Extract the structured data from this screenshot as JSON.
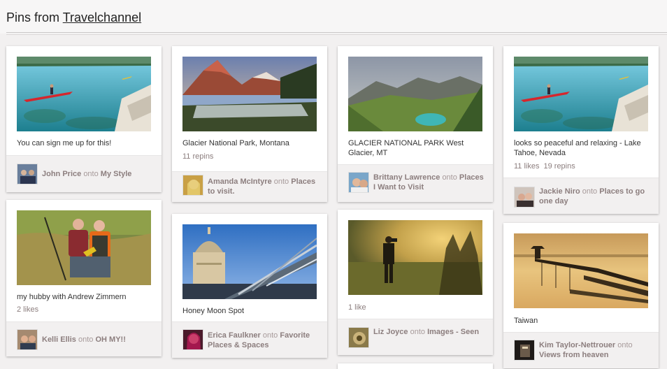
{
  "header": {
    "prefix": "Pins from",
    "user": "Travelchannel"
  },
  "pins": [
    {
      "description": "You can sign me up for this!",
      "stats": [],
      "pinner": "John Price",
      "onto": "onto",
      "board": "My Style",
      "image": "kayak-lake-icon"
    },
    {
      "description": "my hubby with Andrew Zimmern",
      "stats": [
        "2 likes"
      ],
      "pinner": "Kelli Ellis",
      "onto": "onto",
      "board": "OH MY!!",
      "image": "two-men-field-icon"
    },
    {
      "description": "Glacier National Park, Montana",
      "stats": [
        "11 repins"
      ],
      "pinner": "Amanda McIntyre",
      "onto": "onto",
      "board": "Places to visit.",
      "image": "mountain-lake-icon"
    },
    {
      "description": "Honey Moon Spot",
      "stats": [],
      "pinner": "Erica Faulkner",
      "onto": "onto",
      "board": "Favorite Places & Spaces",
      "image": "st-pauls-bridge-icon"
    },
    {
      "description": "GLACIER NATIONAL PARK West Glacier, MT",
      "stats": [],
      "pinner": "Brittany Lawrence",
      "onto": "onto",
      "board": "Places I Want to Visit",
      "image": "glacier-valley-icon"
    },
    {
      "description": "",
      "stats": [
        "1 like"
      ],
      "pinner": "Liz Joyce",
      "onto": "onto",
      "board": "Images - Seen",
      "image": "photographer-sunset-icon"
    },
    {
      "description": "looks so peaceful and relaxing - Lake Tahoe, Nevada",
      "stats": [
        "11 likes",
        "19 repins"
      ],
      "pinner": "Jackie Niro",
      "onto": "onto",
      "board": "Places to go one day",
      "image": "kayak-lake-icon"
    },
    {
      "description": "Taiwan",
      "stats": [],
      "pinner": "Kim Taylor-Nettrouer",
      "onto": "onto",
      "board": "Views from heaven",
      "image": "pagoda-pier-icon"
    }
  ]
}
